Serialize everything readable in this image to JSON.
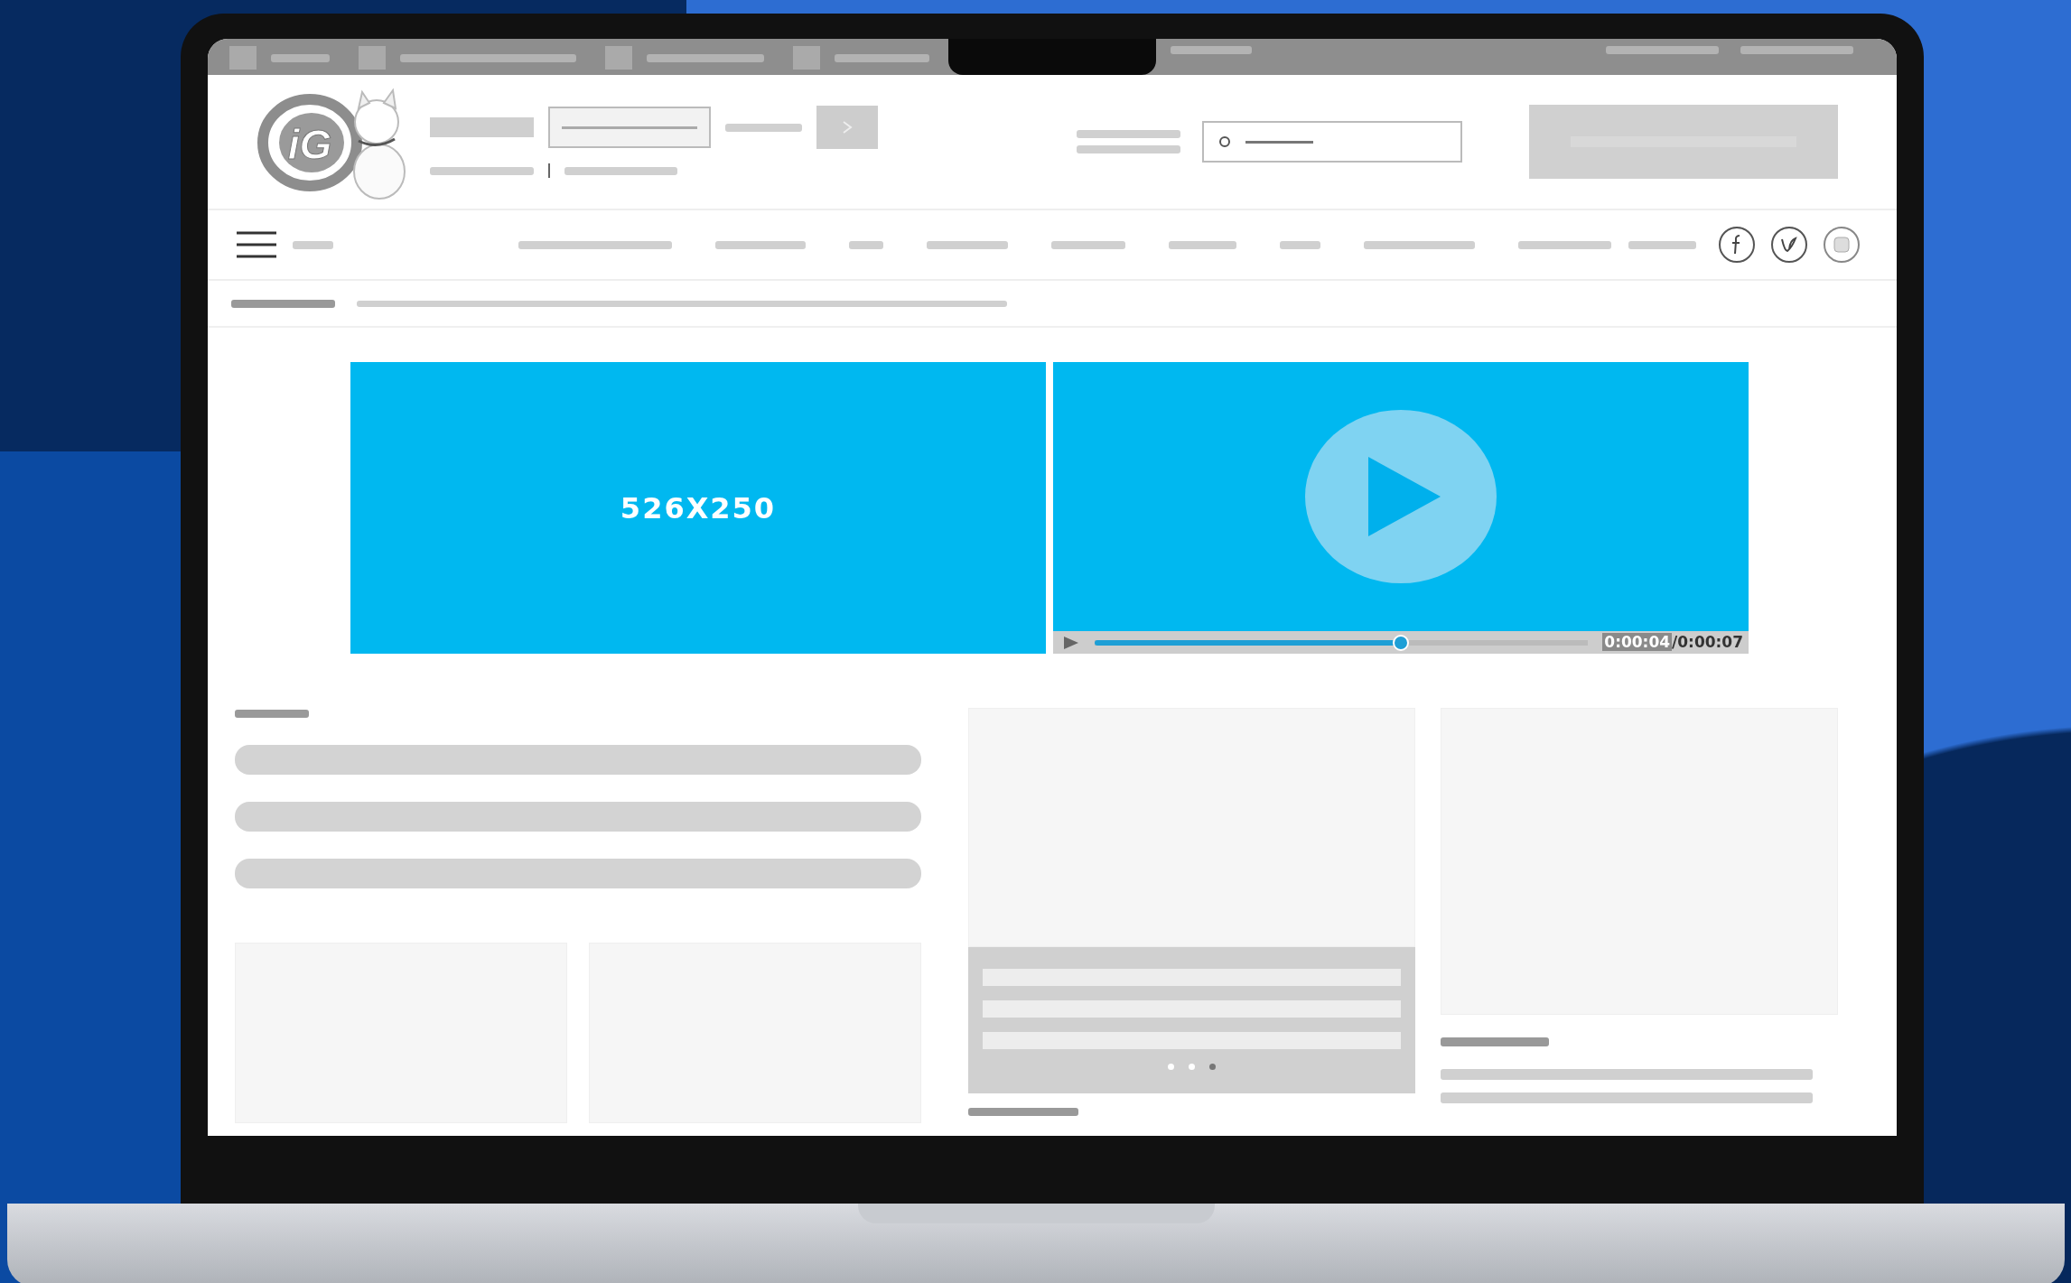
{
  "logo": {
    "text": "iG"
  },
  "banner": {
    "text": "526X250"
  },
  "video": {
    "level": 0.62,
    "elapsed": "0:00:04",
    "total": "/0:00:07"
  },
  "carousel": {
    "dots": [
      {
        "selected": false
      },
      {
        "selected": false
      },
      {
        "selected": true
      }
    ]
  }
}
